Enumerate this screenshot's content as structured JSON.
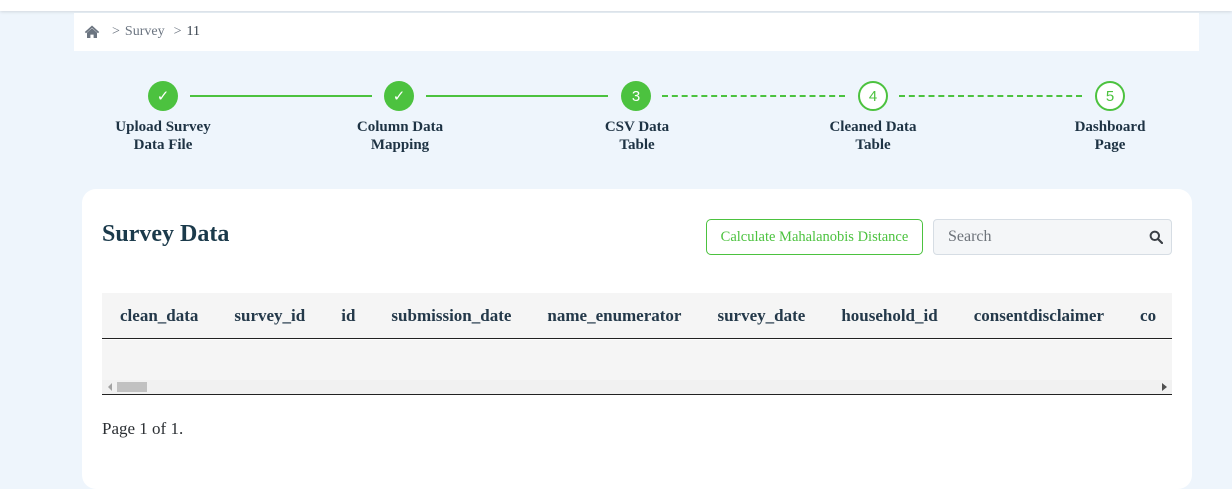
{
  "breadcrumb": {
    "home_icon": "home-icon",
    "separator": ">",
    "items": [
      "Survey",
      "11"
    ]
  },
  "stepper": {
    "accent_color": "#4cc23f",
    "steps": [
      {
        "marker": "✓",
        "label": "Upload Survey\nData File",
        "state": "completed"
      },
      {
        "marker": "✓",
        "label": "Column Data\nMapping",
        "state": "completed"
      },
      {
        "marker": "3",
        "label": "CSV Data\nTable",
        "state": "current"
      },
      {
        "marker": "4",
        "label": "Cleaned Data\nTable",
        "state": "pending"
      },
      {
        "marker": "5",
        "label": "Dashboard\nPage",
        "state": "pending"
      }
    ]
  },
  "card": {
    "title": "Survey Data",
    "calculate_button": "Calculate Mahalanobis Distance",
    "search": {
      "placeholder": "Search",
      "value": "",
      "icon": "search-icon"
    },
    "table": {
      "columns": [
        "clean_data",
        "survey_id",
        "id",
        "submission_date",
        "name_enumerator",
        "survey_date",
        "household_id",
        "consentdisclaimer",
        "co"
      ],
      "rows": []
    },
    "pager": "Page 1 of 1."
  }
}
